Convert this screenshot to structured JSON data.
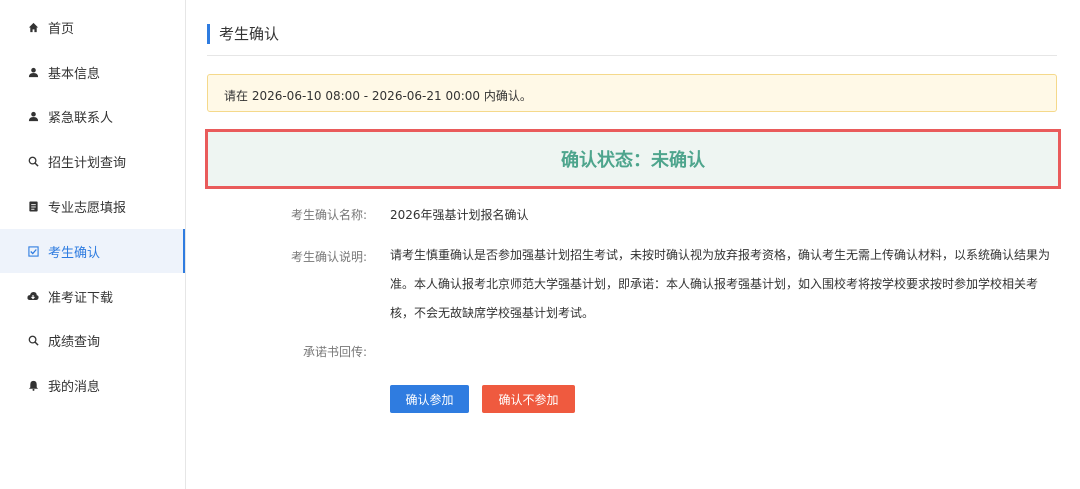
{
  "sidebar": {
    "items": [
      {
        "label": "首页",
        "icon": "home-icon"
      },
      {
        "label": "基本信息",
        "icon": "user-icon"
      },
      {
        "label": "紧急联系人",
        "icon": "user-icon"
      },
      {
        "label": "招生计划查询",
        "icon": "search-icon"
      },
      {
        "label": "专业志愿填报",
        "icon": "document-icon"
      },
      {
        "label": "考生确认",
        "icon": "checkbox-icon"
      },
      {
        "label": "准考证下载",
        "icon": "cloud-download-icon"
      },
      {
        "label": "成绩查询",
        "icon": "search-icon"
      },
      {
        "label": "我的消息",
        "icon": "bell-icon"
      }
    ],
    "active_index": 5
  },
  "page": {
    "title": "考生确认",
    "notice": "请在 2026-06-10 08:00 - 2026-06-21 00:00 内确认。",
    "status": "确认状态：未确认"
  },
  "form": {
    "name_label": "考生确认名称:",
    "name_value": "2026年强基计划报名确认",
    "desc_label": "考生确认说明:",
    "desc_value": "请考生慎重确认是否参加强基计划招生考试，未按时确认视为放弃报考资格，确认考生无需上传确认材料，以系统确认结果为准。本人确认报考北京师范大学强基计划，即承诺：本人确认报考强基计划，如入围校考将按学校要求按时参加学校相关考核，不会无故缺席学校强基计划考试。",
    "upload_label": "承诺书回传:"
  },
  "buttons": {
    "confirm": "确认参加",
    "decline": "确认不参加"
  },
  "colors": {
    "accent": "#2f7ce0",
    "status_text": "#4ea58d",
    "highlight_border": "#e95b5b",
    "decline_button": "#ef5a3f"
  }
}
